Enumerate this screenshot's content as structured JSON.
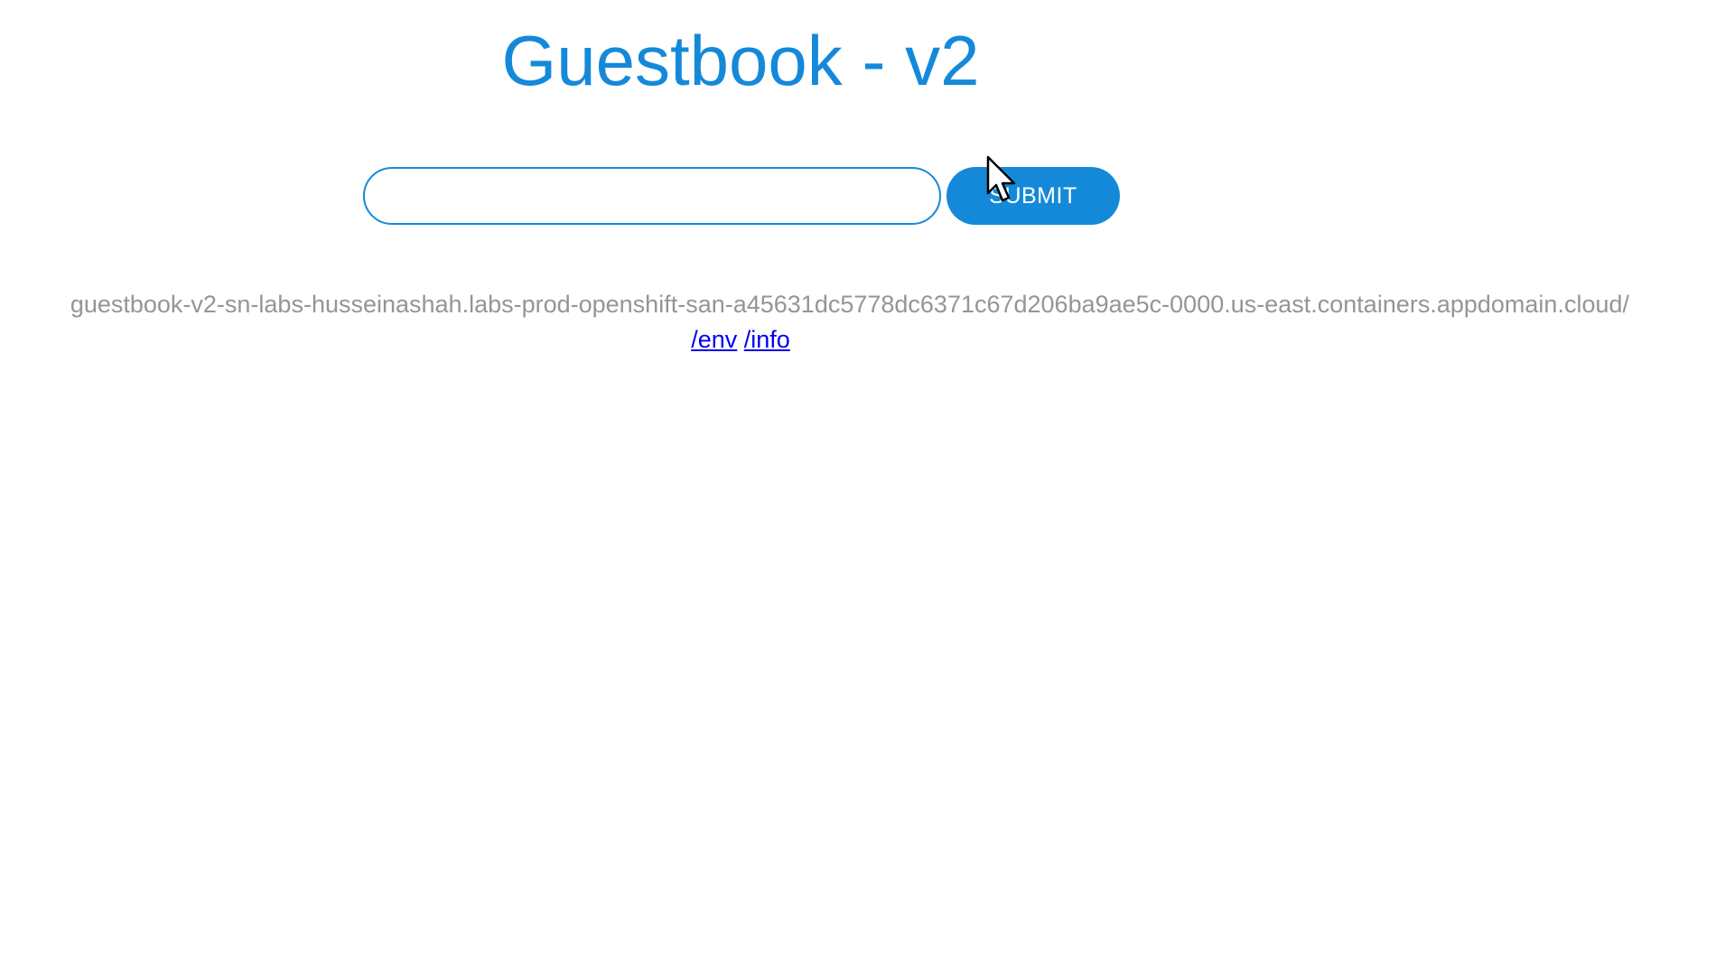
{
  "header": {
    "title": "Guestbook - v2"
  },
  "form": {
    "input_value": "",
    "input_placeholder": "",
    "submit_label": "SUBMIT"
  },
  "host": {
    "text": "guestbook-v2-sn-labs-husseinashah.labs-prod-openshift-san-a45631dc5778dc6371c67d206ba9ae5c-0000.us-east.containers.appdomain.cloud/"
  },
  "links": {
    "env_label": "/env",
    "info_label": "/info"
  },
  "cursor": {
    "icon": "mouse-pointer-icon"
  },
  "colors": {
    "accent": "#1589d9",
    "host_text": "#959595",
    "link": "#0000ee"
  }
}
